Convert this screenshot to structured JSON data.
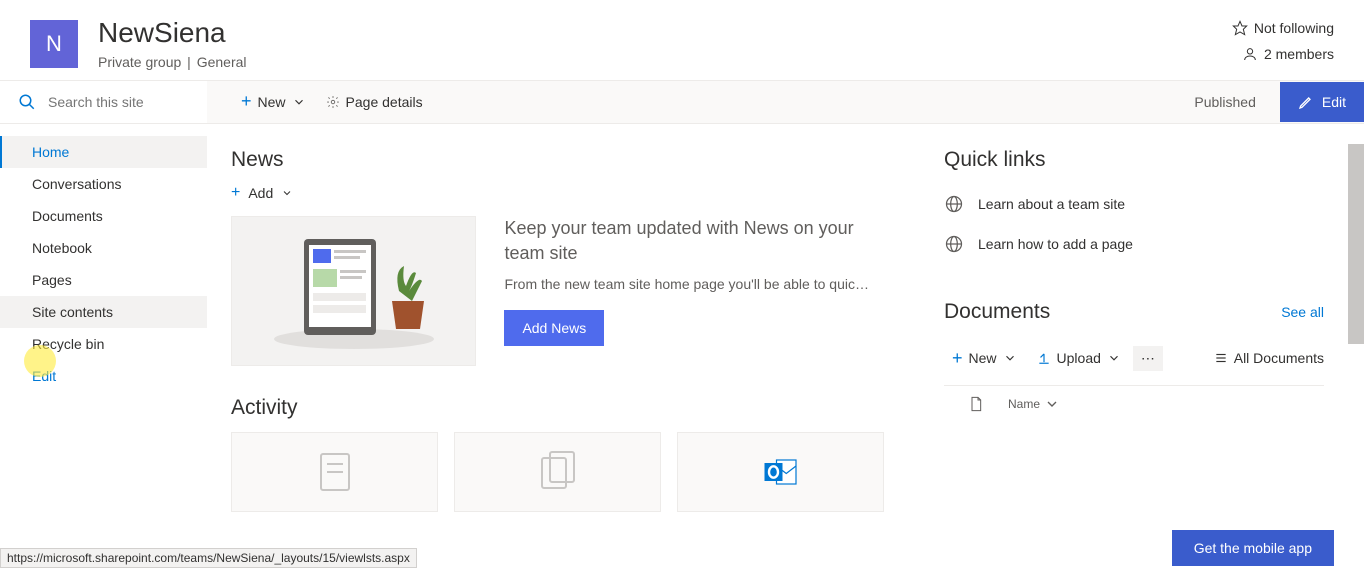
{
  "header": {
    "logo_letter": "N",
    "title": "NewSiena",
    "group_type": "Private group",
    "separator": "|",
    "channel": "General",
    "follow_label": "Not following",
    "members_label": "2 members"
  },
  "search": {
    "placeholder": "Search this site"
  },
  "cmdbar": {
    "new_label": "New",
    "page_details_label": "Page details",
    "published_label": "Published",
    "edit_label": "Edit"
  },
  "nav": {
    "items": [
      {
        "label": "Home",
        "active": true
      },
      {
        "label": "Conversations"
      },
      {
        "label": "Documents"
      },
      {
        "label": "Notebook"
      },
      {
        "label": "Pages"
      },
      {
        "label": "Site contents",
        "hover": true
      },
      {
        "label": "Recycle bin"
      },
      {
        "label": "Edit",
        "edit": true
      }
    ]
  },
  "news": {
    "title": "News",
    "add_label": "Add",
    "promo_title": "Keep your team updated with News on your team site",
    "promo_body": "From the new team site home page you'll be able to quic…",
    "button_label": "Add News"
  },
  "activity": {
    "title": "Activity"
  },
  "quicklinks": {
    "title": "Quick links",
    "items": [
      {
        "label": "Learn about a team site"
      },
      {
        "label": "Learn how to add a page"
      }
    ]
  },
  "documents": {
    "title": "Documents",
    "see_all_label": "See all",
    "new_label": "New",
    "upload_label": "Upload",
    "all_docs_label": "All Documents",
    "col_name": "Name"
  },
  "mobile": {
    "button_label": "Get the mobile app"
  },
  "status_url": "https://microsoft.sharepoint.com/teams/NewSiena/_layouts/15/viewlsts.aspx"
}
